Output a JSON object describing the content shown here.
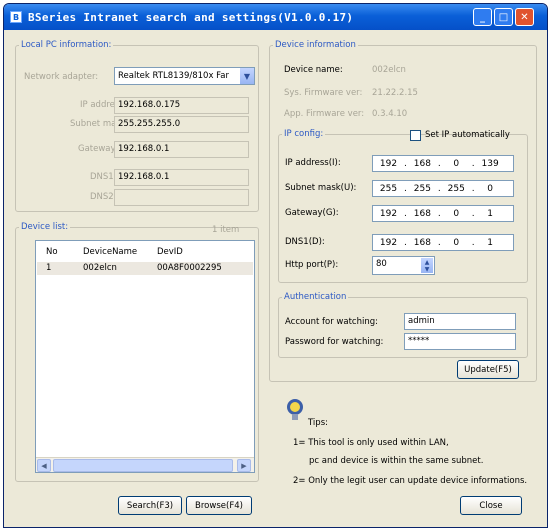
{
  "window": {
    "title": "BSeries Intranet search and settings(V1.0.0.17)",
    "title_icon": "app-icon"
  },
  "local_pc": {
    "legend": "Local PC information:",
    "network_adapter_label": "Network adapter:",
    "network_adapter_value": "Realtek RTL8139/810x Far",
    "ip_label": "IP address:",
    "ip_value": "192.168.0.175",
    "subnet_label": "Subnet mask:",
    "subnet_value": "255.255.255.0",
    "gateway_label": "Gateway:",
    "gateway_value": "192.168.0.1",
    "dns1_label": "DNS1:",
    "dns1_value": "192.168.0.1",
    "dns2_label": "DNS2:",
    "dns2_value": ""
  },
  "device_list": {
    "legend": "Device list:",
    "count": "1 item",
    "columns": [
      "No",
      "DeviceName",
      "DevID"
    ],
    "rows": [
      {
        "no": "1",
        "name": "002elcn",
        "id": "00A8F0002295"
      }
    ]
  },
  "device_info": {
    "legend": "Device information",
    "name_label": "Device name:",
    "name_value": "002elcn",
    "sys_fw_label": "Sys. Firmware ver:",
    "sys_fw_value": "21.22.2.15",
    "app_fw_label": "App. Firmware ver:",
    "app_fw_value": "0.3.4.10"
  },
  "ip_config": {
    "legend": "IP config:",
    "auto_label": "Set IP automatically",
    "ip_label": "IP address(I):",
    "ip": [
      "192",
      "168",
      "0",
      "139"
    ],
    "subnet_label": "Subnet mask(U):",
    "subnet": [
      "255",
      "255",
      "255",
      "0"
    ],
    "gateway_label": "Gateway(G):",
    "gateway": [
      "192",
      "168",
      "0",
      "1"
    ],
    "dns1_label": "DNS1(D):",
    "dns1": [
      "192",
      "168",
      "0",
      "1"
    ],
    "http_label": "Http port(P):",
    "http_value": "80"
  },
  "auth": {
    "legend": "Authentication",
    "account_label": "Account for watching:",
    "account_value": "admin",
    "password_label": "Password for watching:",
    "password_value": "*****",
    "update_label": "Update(F5)"
  },
  "tips": {
    "title": "Tips:",
    "line1": "1= This tool is only used within LAN,",
    "line2": "pc and device is within the same subnet.",
    "line3": "2= Only the legit user can update device informations."
  },
  "buttons": {
    "search": "Search(F3)",
    "browse": "Browse(F4)",
    "close": "Close"
  }
}
